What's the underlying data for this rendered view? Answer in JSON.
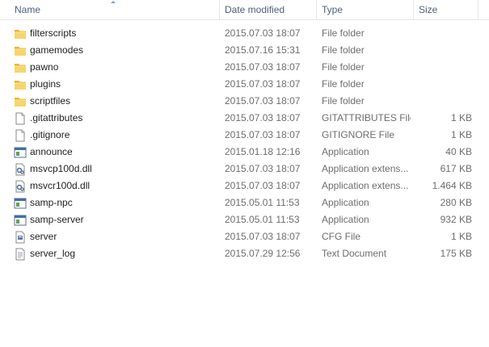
{
  "columns": {
    "name": "Name",
    "date": "Date modified",
    "type": "Type",
    "size": "Size"
  },
  "files": [
    {
      "name": "filterscripts",
      "date": "2015.07.03 18:07",
      "type": "File folder",
      "size": "",
      "icon": "folder-icon"
    },
    {
      "name": "gamemodes",
      "date": "2015.07.16 15:31",
      "type": "File folder",
      "size": "",
      "icon": "folder-icon"
    },
    {
      "name": "pawno",
      "date": "2015.07.03 18:07",
      "type": "File folder",
      "size": "",
      "icon": "folder-icon"
    },
    {
      "name": "plugins",
      "date": "2015.07.03 18:07",
      "type": "File folder",
      "size": "",
      "icon": "folder-icon"
    },
    {
      "name": "scriptfiles",
      "date": "2015.07.03 18:07",
      "type": "File folder",
      "size": "",
      "icon": "folder-icon"
    },
    {
      "name": ".gitattributes",
      "date": "2015.07.03 18:07",
      "type": "GITATTRIBUTES File",
      "size": "1 KB",
      "icon": "blank-file-icon"
    },
    {
      "name": ".gitignore",
      "date": "2015.07.03 18:07",
      "type": "GITIGNORE File",
      "size": "1 KB",
      "icon": "blank-file-icon"
    },
    {
      "name": "announce",
      "date": "2015.01.18 12:16",
      "type": "Application",
      "size": "40 KB",
      "icon": "application-icon"
    },
    {
      "name": "msvcp100d.dll",
      "date": "2015.07.03 18:07",
      "type": "Application extens...",
      "size": "617 KB",
      "icon": "dll-icon"
    },
    {
      "name": "msvcr100d.dll",
      "date": "2015.07.03 18:07",
      "type": "Application extens...",
      "size": "1.464 KB",
      "icon": "dll-icon"
    },
    {
      "name": "samp-npc",
      "date": "2015.05.01 11:53",
      "type": "Application",
      "size": "280 KB",
      "icon": "application-icon"
    },
    {
      "name": "samp-server",
      "date": "2015.05.01 11:53",
      "type": "Application",
      "size": "932 KB",
      "icon": "application-icon"
    },
    {
      "name": "server",
      "date": "2015.07.03 18:07",
      "type": "CFG File",
      "size": "1 KB",
      "icon": "config-file-icon"
    },
    {
      "name": "server_log",
      "date": "2015.07.29 12:56",
      "type": "Text Document",
      "size": "175 KB",
      "icon": "text-file-icon"
    }
  ]
}
